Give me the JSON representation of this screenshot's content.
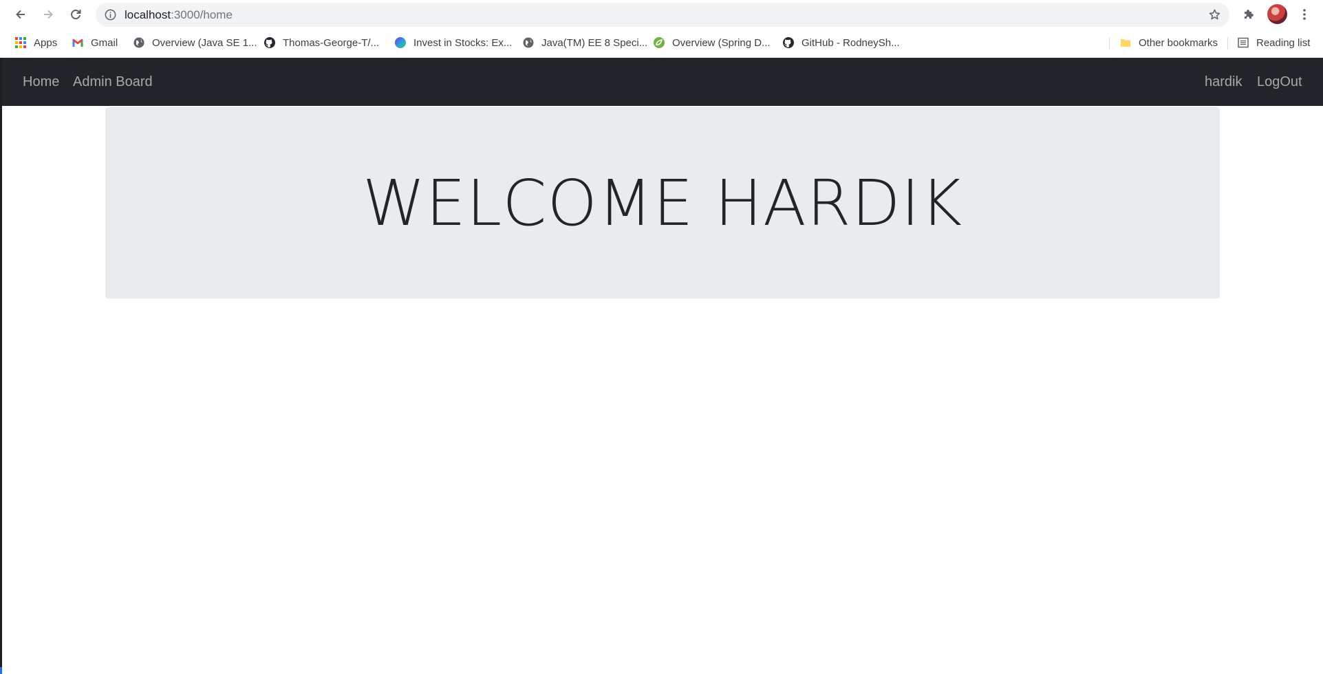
{
  "browser": {
    "url_host": "localhost",
    "url_path": ":3000/home",
    "icons": {
      "back": "arrow-left-icon",
      "forward": "arrow-right-icon",
      "reload": "reload-icon",
      "site_info": "info-icon",
      "bookmark_star": "star-icon",
      "extensions": "puzzle-icon",
      "menu": "kebab-menu-icon"
    }
  },
  "bookmarks": {
    "items": [
      {
        "label": "Apps",
        "icon": "apps-grid-icon"
      },
      {
        "label": "Gmail",
        "icon": "gmail-icon"
      },
      {
        "label": "Overview (Java SE 1...",
        "icon": "globe-icon"
      },
      {
        "label": "Thomas-George-T/...",
        "icon": "github-icon"
      },
      {
        "label": "Invest in Stocks: Ex...",
        "icon": "invest-icon"
      },
      {
        "label": "Java(TM) EE 8 Speci...",
        "icon": "globe-icon"
      },
      {
        "label": "Overview (Spring D...",
        "icon": "spring-icon"
      },
      {
        "label": "GitHub - RodneySh...",
        "icon": "github-icon"
      }
    ],
    "other_bookmarks": "Other bookmarks",
    "reading_list": "Reading list"
  },
  "navbar": {
    "left": [
      "Home",
      "Admin Board"
    ],
    "right": [
      "hardik",
      "LogOut"
    ],
    "background": "#212529"
  },
  "jumbotron": {
    "title": "WELCOME HARDIK",
    "background": "#e9ecef"
  }
}
